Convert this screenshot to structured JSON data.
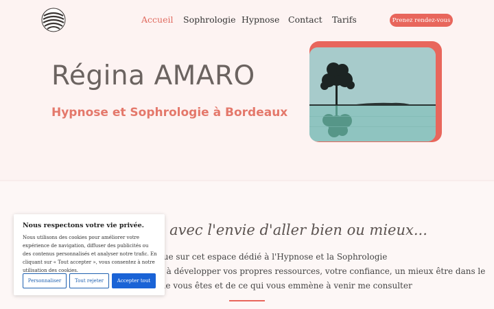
{
  "nav": {
    "items": [
      "Accueil",
      "Sophrologie",
      "Hypnose",
      "Contact",
      "Tarifs"
    ],
    "cta": "Prenez rendez-vous"
  },
  "hero": {
    "name": "Régina AMARO",
    "subtitle": "Hypnose et Sophrologie à Bordeaux"
  },
  "section": {
    "tagline": "e avec l'envie d'aller bien ou mieux...",
    "lines": [
      "nue sur cet espace dédié à l'Hypnose et la Sophrologie",
      "er à développer vos propres ressources, votre confiance, un mieux être dans le",
      "que vous êtes et de ce qui vous emmène à venir me consulter"
    ]
  },
  "cookie": {
    "title": "Nous respectons votre vie privée.",
    "text": "Nous utilisons des cookies pour améliorer votre expérience de navigation, diffuser des publicités ou des contenus personnalisés et analyser notre trafic. En cliquant sur « Tout accepter », vous consentez à notre utilisation des cookies.",
    "buttons": [
      "Personnaliser",
      "Tout rejeter",
      "Accepter tout"
    ]
  },
  "colors": {
    "accent": "#e8665c",
    "background": "#fdf3f2",
    "cookie_primary": "#1a63d6"
  },
  "icons": [
    "logo-icon"
  ]
}
